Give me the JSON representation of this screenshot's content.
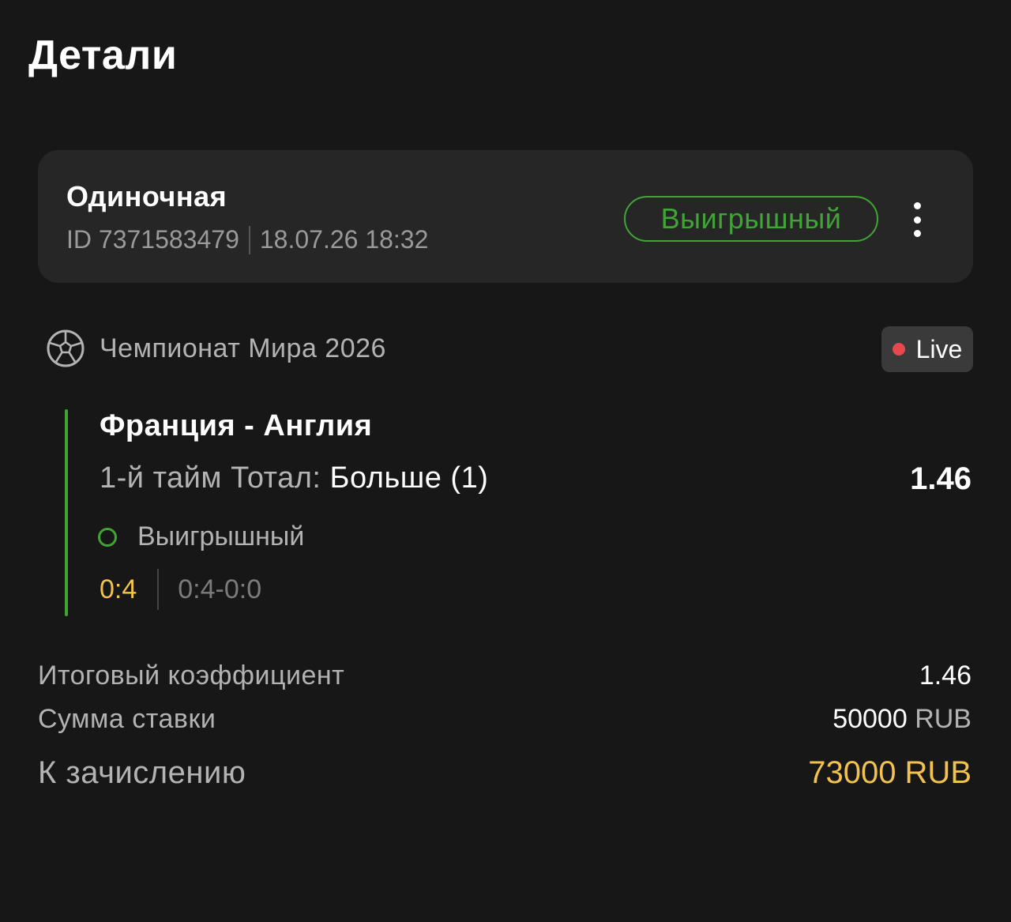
{
  "header": {
    "title": "Детали"
  },
  "bet": {
    "type": "Одиночная",
    "id": "ID 7371583479",
    "datetime": "18.07.26 18:32",
    "status": "Выигрышный"
  },
  "event": {
    "sport_icon": "soccer-ball-icon",
    "tournament": "Чемпионат Мира 2026",
    "live_label": "Live",
    "match": "Франция - Англия",
    "market": "1-й тайм Тотал:",
    "outcome": "Больше (1)",
    "odds": "1.46",
    "status": "Выигрышный",
    "score": "0:4",
    "score_detail": "0:4-0:0"
  },
  "summary": {
    "total_odds_label": "Итоговый коэффициент",
    "total_odds_value": "1.46",
    "stake_label": "Сумма ставки",
    "stake_amount": "50000",
    "stake_currency": "RUB",
    "payout_label": "К зачислению",
    "payout_value": "73000 RUB"
  },
  "colors": {
    "background": "#171717",
    "card": "#262626",
    "win_green": "#3fa535",
    "accent_gold": "#f2c14e",
    "live_red": "#e5484d"
  }
}
